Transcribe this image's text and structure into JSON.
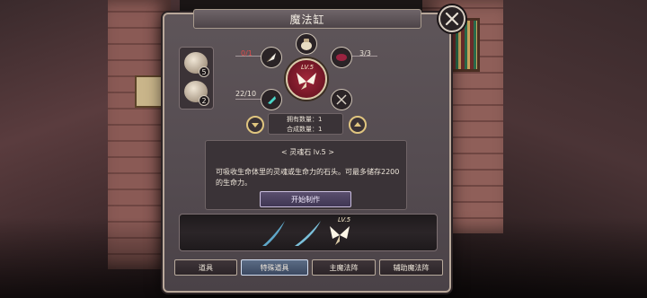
{
  "window": {
    "title": "魔法缸",
    "close_icon": "close-x-icon"
  },
  "materials": [
    {
      "icon": "scroll-bag-icon",
      "count": "5"
    },
    {
      "icon": "pouch-icon",
      "count": "2"
    }
  ],
  "recipe": {
    "center_level": "LV.5",
    "center_icon": "spirit-butterfly-icon",
    "slots": [
      {
        "icon": "bag-icon",
        "label": ""
      },
      {
        "icon": "white-feather-icon",
        "label": "0/1"
      },
      {
        "icon": "red-gem-icon",
        "label": "3/3"
      },
      {
        "icon": "cyan-crystal-icon",
        "label": "22/10"
      },
      {
        "icon": "crossed-x-icon",
        "label": ""
      }
    ],
    "owned_label": "拥有数量：",
    "owned_value": "1",
    "craft_count_label": "合成数量：",
    "craft_count_value": "1"
  },
  "item": {
    "name": "< 灵魂石 lv.5 >",
    "description": "可吸收生命体里的灵魂或生命力的石头。可最多储存2200的生命力。",
    "craft_button": "开始制作"
  },
  "strip": {
    "items": [
      "blue-blade-icon",
      "blue-blade-icon",
      "spirit-butterfly-icon"
    ],
    "level": "LV.5"
  },
  "tabs": [
    {
      "label": "道具",
      "active": false
    },
    {
      "label": "特殊道具",
      "active": true
    },
    {
      "label": "主魔法阵",
      "active": false
    },
    {
      "label": "辅助魔法阵",
      "active": false
    }
  ],
  "colors": {
    "accent_gold": "#e0c57f",
    "red_count": "#e04a4a",
    "active_tab": "#5b6c85"
  }
}
